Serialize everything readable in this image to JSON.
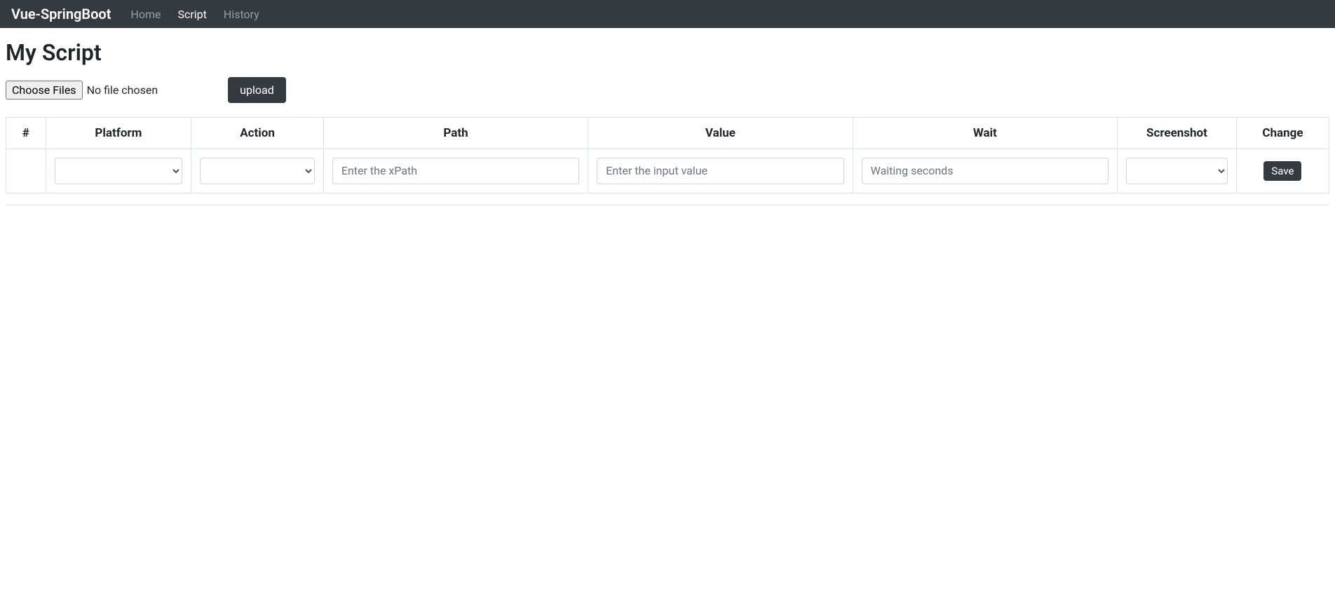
{
  "navbar": {
    "brand": "Vue-SpringBoot",
    "links": [
      {
        "label": "Home",
        "active": false
      },
      {
        "label": "Script",
        "active": true
      },
      {
        "label": "History",
        "active": false
      }
    ]
  },
  "page": {
    "title": "My Script"
  },
  "upload": {
    "choose_files_label": "Choose Files",
    "file_status": "No file chosen",
    "upload_button_label": "upload"
  },
  "table": {
    "headers": {
      "hash": "#",
      "platform": "Platform",
      "action": "Action",
      "path": "Path",
      "value": "Value",
      "wait": "Wait",
      "screenshot": "Screenshot",
      "change": "Change"
    },
    "row": {
      "path_placeholder": "Enter the xPath",
      "value_placeholder": "Enter the input value",
      "wait_placeholder": "Waiting seconds",
      "save_label": "Save"
    }
  }
}
